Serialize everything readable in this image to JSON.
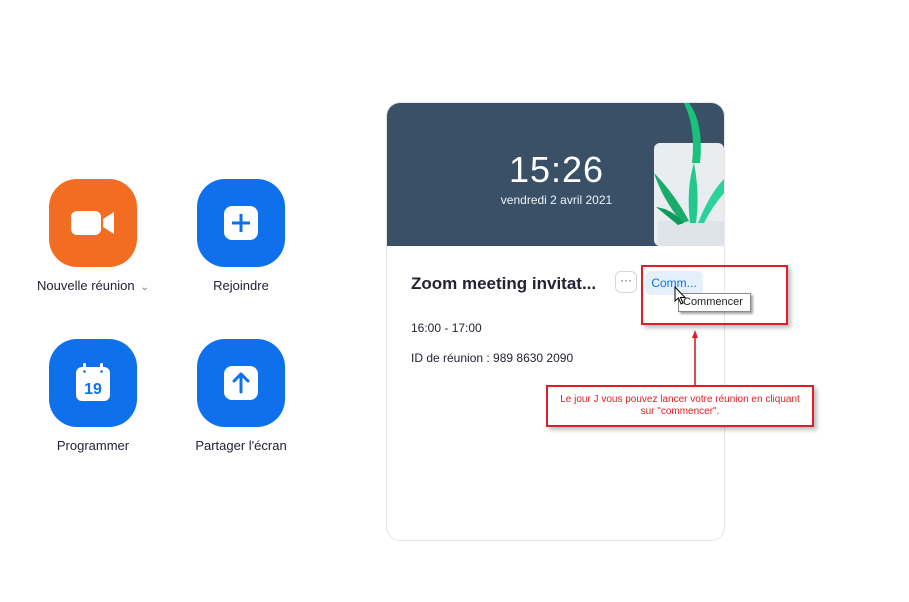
{
  "actions": {
    "new_meeting": {
      "label": "Nouvelle réunion",
      "caret": "⌄",
      "color": "#f26d21",
      "icon": "video-camera-icon"
    },
    "join": {
      "label": "Rejoindre",
      "color": "#0e71eb",
      "icon": "plus-icon"
    },
    "schedule": {
      "label": "Programmer",
      "day": "19",
      "color": "#0e71eb",
      "icon": "calendar-icon"
    },
    "share_screen": {
      "label": "Partager l'écran",
      "color": "#0e71eb",
      "icon": "arrow-up-icon"
    }
  },
  "card": {
    "time": "15:26",
    "date": "vendredi 2 avril 2021",
    "header_color": "#3a5066",
    "meeting": {
      "title": "Zoom meeting invitat...",
      "more_label": "···",
      "start_label": "Comm...",
      "time_range": "16:00 - 17:00",
      "id_text": "ID de réunion : 989 8630 2090"
    }
  },
  "tooltip": {
    "text": "Commencer"
  },
  "annotation": {
    "text": "Le jour J vous pouvez lancer votre réunion en cliquant sur \"commencer\".",
    "color": "#e11d26"
  }
}
